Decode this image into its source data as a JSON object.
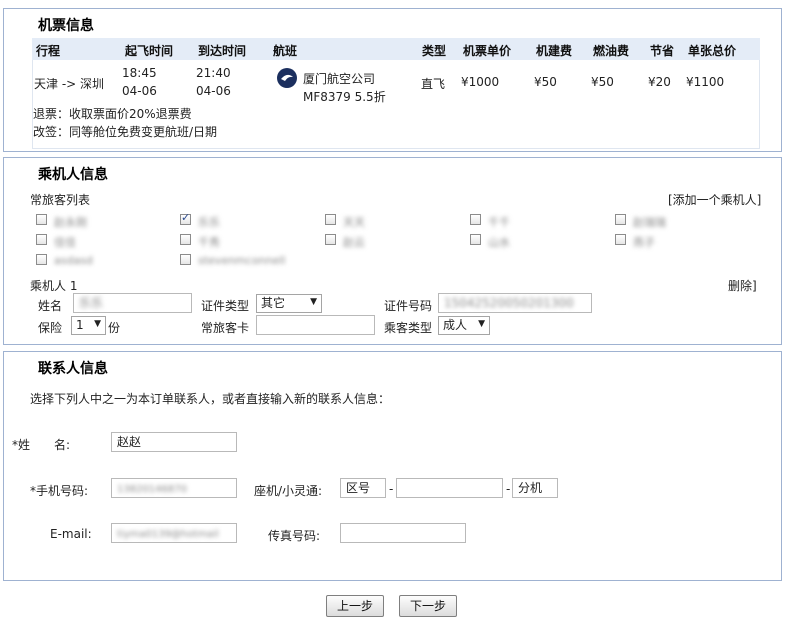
{
  "flight": {
    "title": "机票信息",
    "headers": [
      "行程",
      "起飞时间",
      "到达时间",
      "航班",
      "类型",
      "机票单价",
      "机建费",
      "燃油费",
      "节省",
      "单张总价"
    ],
    "route": "天津 -> 深圳",
    "depart_time": "18:45",
    "depart_date": "04-06",
    "arrive_time": "21:40",
    "arrive_date": "04-06",
    "airline": "厦门航空公司",
    "flight_no": "MF8379 5.5折",
    "type": "直飞",
    "price": "¥1000",
    "airport_fee": "¥50",
    "fuel_fee": "¥50",
    "saving": "¥20",
    "total": "¥1100",
    "refund_rule": "退票：收取票面价20%退票费",
    "change_rule": "改签：同等舱位免费变更航班/日期"
  },
  "passenger": {
    "title": "乘机人信息",
    "frequent_list_label": "常旅客列表",
    "add_link": "[添加一个乘机人]",
    "frequent": [
      {
        "name": "赵永刚",
        "checked": false
      },
      {
        "name": "乐乐",
        "checked": true
      },
      {
        "name": "天天",
        "checked": false
      },
      {
        "name": "千千",
        "checked": false
      },
      {
        "name": "赵瑞瑞",
        "checked": false
      },
      {
        "name": "佳佳",
        "checked": false
      },
      {
        "name": "千秀",
        "checked": false
      },
      {
        "name": "赵云",
        "checked": false
      },
      {
        "name": "山水",
        "checked": false
      },
      {
        "name": "燕子",
        "checked": false
      },
      {
        "name": "asdasd",
        "checked": false
      },
      {
        "name": "stevenmconnell",
        "checked": false
      }
    ],
    "item_label": "乘机人 1",
    "delete_link": "删除]",
    "name_label": "姓名",
    "name_value": "乐乐",
    "id_type_label": "证件类型",
    "id_type_value": "其它",
    "id_no_label": "证件号码",
    "id_no_value": "15042520050201300",
    "insurance_label": "保险",
    "insurance_value": "1",
    "insurance_unit": "份",
    "ff_card_label": "常旅客卡",
    "ff_card_value": "",
    "pax_type_label": "乘客类型",
    "pax_type_value": "成人"
  },
  "contact": {
    "title": "联系人信息",
    "instruction": "选择下列人中之一为本订单联系人，或者直接输入新的联系人信息：",
    "name_label": "*姓　　名:",
    "name_value": "赵赵",
    "mobile_label": "*手机号码:",
    "mobile_value": "13820146870",
    "landline_label": "座机/小灵通:",
    "area_code_placeholder": "区号",
    "dash": "-",
    "ext_placeholder": "分机号",
    "email_label": "E-mail:",
    "email_value": "tiyma0139@hotmail",
    "fax_label": "传真号码:"
  },
  "buttons": {
    "prev": "上一步",
    "next": "下一步"
  }
}
